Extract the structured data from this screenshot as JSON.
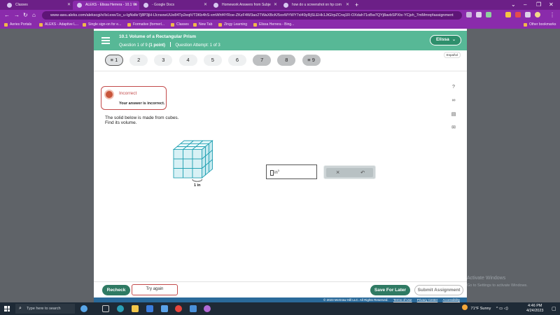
{
  "browser": {
    "tabs": [
      {
        "title": "Classes",
        "active": false
      },
      {
        "title": "ALEKS - Elissa Herrera - 10.1 Vo",
        "active": true
      },
      {
        "title": "- Google Docs",
        "active": false
      },
      {
        "title": "Homework Answers from Subje",
        "active": false
      },
      {
        "title": "how do u screenshot on hp com",
        "active": false
      }
    ],
    "new_tab": "+",
    "window_controls": [
      "⌄",
      "–",
      "❐",
      "✕"
    ],
    "url": "www-awu.aleks.com/alekscgi/x/Isl.exe/1o_u-IgNslkr7j8P3jH-lJcnsxwUUe84Tp2eqtVT3Kb4hS-xmWhf4YRoe-ZKzF4W3ao2TWaXBcK/5oxWYWY7xl49yRjSLEHk1JtGlrpZCnq1R-OXdah71oBw7QYj8avbSPXtx-YCjsh_7mMmrq#assignment",
    "bookmarks": [
      "Aeries Portals",
      "ALEKS - Adaptive L...",
      "Single sign-on for e...",
      "Formative (formerl...",
      "Classes",
      "New Tab",
      "Zingy Learning",
      "Elissa Herrera - Bing..."
    ],
    "other_bookmarks": "Other bookmarks"
  },
  "header": {
    "topic": "10.1 Volume of a Rectangular Prism",
    "question_label": "Question 1 of 9",
    "points": "(1 point)",
    "attempt": "Question Attempt: 1 of 3",
    "user": "Elissa",
    "language": "Español"
  },
  "question_nav": [
    {
      "label": "1",
      "prefix": "≡",
      "state": "current"
    },
    {
      "label": "2",
      "prefix": "",
      "state": "open"
    },
    {
      "label": "3",
      "prefix": "",
      "state": "open"
    },
    {
      "label": "4",
      "prefix": "",
      "state": "open"
    },
    {
      "label": "5",
      "prefix": "",
      "state": "open"
    },
    {
      "label": "6",
      "prefix": "",
      "state": "open"
    },
    {
      "label": "7",
      "prefix": "",
      "state": "done"
    },
    {
      "label": "8",
      "prefix": "",
      "state": "done"
    },
    {
      "label": "9",
      "prefix": "≡",
      "state": "done"
    }
  ],
  "feedback": {
    "title": "Incorrect",
    "message": "Your answer is incorrect."
  },
  "problem": {
    "line1": "The solid below is made from cubes.",
    "line2": "Find its volume.",
    "scale_label": "1 in",
    "grid": {
      "rows": 3,
      "cols": 3,
      "depth": 3
    }
  },
  "answer": {
    "value": "",
    "unit": "in",
    "exponent": "3"
  },
  "tools": {
    "clear": "×",
    "undo": "↶"
  },
  "side_icons": [
    "?",
    "∞",
    "▤",
    "✉"
  ],
  "footer": {
    "recheck": "Recheck",
    "try_again": "Try again",
    "save_later": "Save For Later",
    "submit": "Submit Assignment",
    "copyright": "© 2023 McGraw Hill LLC. All Rights Reserved.",
    "links": [
      "Terms of Use",
      "Privacy Center",
      "Accessibility"
    ]
  },
  "watermark": {
    "title": "Activate Windows",
    "subtitle": "Go to Settings to activate Windows."
  },
  "taskbar": {
    "search_placeholder": "Type here to search",
    "weather": "71°F  Sunny",
    "time": "4:46 PM",
    "date": "4/24/2023"
  },
  "colors": {
    "header_green": "#57b896",
    "button_green": "#2f7a63",
    "incorrect_red": "#c34a4a",
    "cube_teal": "#22a1b3"
  }
}
